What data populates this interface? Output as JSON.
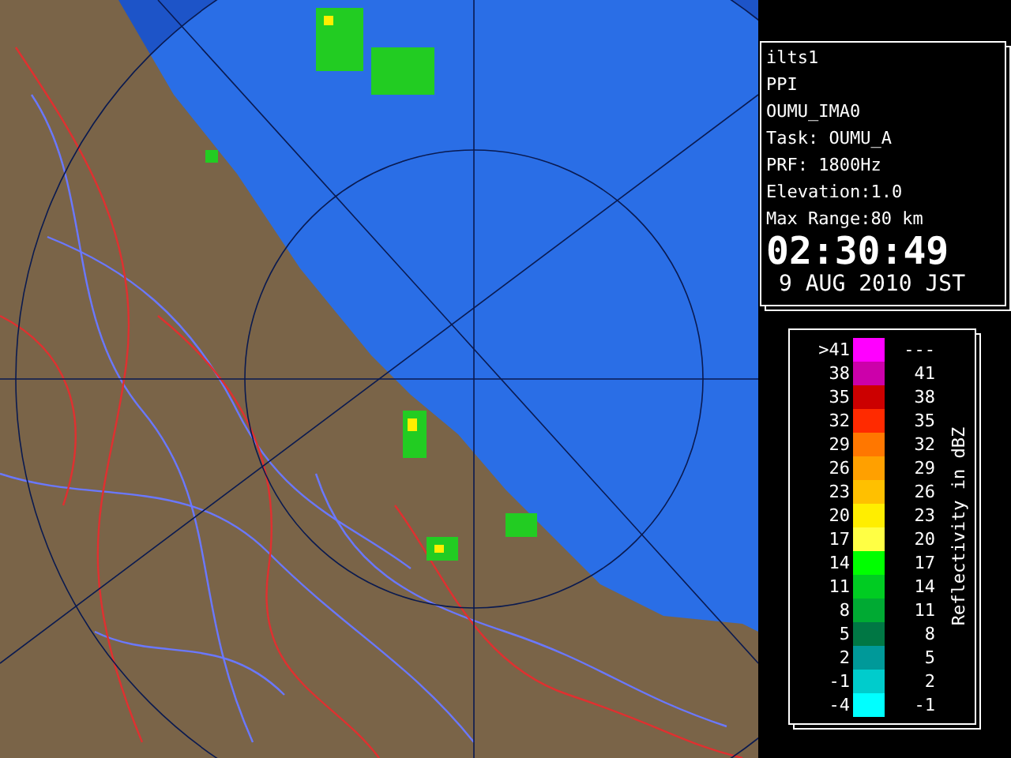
{
  "info": {
    "lines": [
      "ilts1",
      "PPI",
      "OUMU_IMA0",
      "Task: OUMU_A",
      "PRF: 1800Hz",
      "Elevation:1.0",
      "Max Range:80 km"
    ],
    "time": "02:30:49",
    "date": "9 AUG 2010 JST"
  },
  "legend": {
    "title": "Reflectivity in dBZ",
    "rows": [
      {
        "low": ">41",
        "high": "---",
        "color": "#ff00ff"
      },
      {
        "low": "38",
        "high": "41",
        "color": "#cc00aa"
      },
      {
        "low": "35",
        "high": "38",
        "color": "#cc0000"
      },
      {
        "low": "32",
        "high": "35",
        "color": "#ff2a00"
      },
      {
        "low": "29",
        "high": "32",
        "color": "#ff7700"
      },
      {
        "low": "26",
        "high": "29",
        "color": "#ffa000"
      },
      {
        "low": "23",
        "high": "26",
        "color": "#ffc000"
      },
      {
        "low": "20",
        "high": "23",
        "color": "#ffee00"
      },
      {
        "low": "17",
        "high": "20",
        "color": "#ffff44"
      },
      {
        "low": "14",
        "high": "17",
        "color": "#00ff00"
      },
      {
        "low": "11",
        "high": "14",
        "color": "#00cc22"
      },
      {
        "low": "8",
        "high": "11",
        "color": "#00aa33"
      },
      {
        "low": "5",
        "high": "8",
        "color": "#007744"
      },
      {
        "low": "2",
        "high": "5",
        "color": "#009999"
      },
      {
        "low": "-1",
        "high": "2",
        "color": "#00cccc"
      },
      {
        "low": "-4",
        "high": "-1",
        "color": "#00ffff"
      }
    ]
  }
}
